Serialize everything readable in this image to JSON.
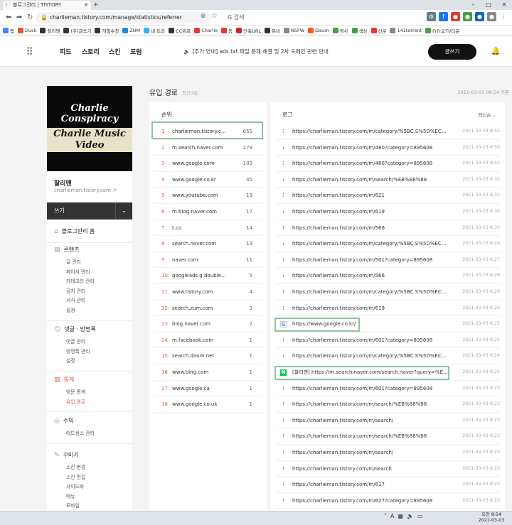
{
  "browser": {
    "tab_title": "블로그관리 | TISTORY",
    "url": "charlieman.tistory.com/manage/statistics/referrer",
    "search_placeholder": "G  검색",
    "bookmarks": [
      {
        "label": "앱",
        "color": "#4285f4"
      },
      {
        "label": "Duck",
        "color": "#de5833"
      },
      {
        "label": "찰리맨",
        "color": "#333333"
      },
      {
        "label": "(주)글쓰기",
        "color": "#333333"
      },
      {
        "label": "개별수정",
        "color": "#333333"
      },
      {
        "label": "ZUM",
        "color": "#1e88e5"
      },
      {
        "label": "내 트라",
        "color": "#29b6f6"
      },
      {
        "label": "CC워프",
        "color": "#333333"
      },
      {
        "label": "Charlie",
        "color": "#e53935"
      },
      {
        "label": "동",
        "color": "#e53935"
      },
      {
        "label": "단축URL",
        "color": "#c62828"
      },
      {
        "label": "뮤비",
        "color": "#333333"
      },
      {
        "label": "NSFW",
        "color": "#888888"
      },
      {
        "label": "Daum",
        "color": "#ff5722"
      },
      {
        "label": "영사",
        "color": "#43a047"
      },
      {
        "label": "색상",
        "color": "#43a047"
      },
      {
        "label": "신문",
        "color": "#e53935"
      },
      {
        "label": "141torrent",
        "color": "#888888"
      },
      {
        "label": "FrFr오TV다운",
        "color": "#43a047"
      }
    ]
  },
  "topnav": {
    "items": [
      "피드",
      "스토리",
      "스킨",
      "포럼"
    ],
    "notice": "[추가 안내] ads.txt 파일 문제 해결 및 2차 도메인 관련 안내",
    "write_button": "글쓰기"
  },
  "sidebar": {
    "blog_image_line1": "Charlie Conspiracy",
    "blog_image_line2": "Charlie Music Video",
    "blog_name": "찰리맨",
    "blog_url": "charlieman.tistory.com",
    "write": "쓰기",
    "home": "블로그관리 홈",
    "sections": [
      {
        "title": "콘텐츠",
        "icon": "document-icon",
        "items": [
          "글 관리",
          "페이지 관리",
          "카테고리 관리",
          "공지 관리",
          "서식 관리",
          "설정"
        ]
      },
      {
        "title": "댓글 · 방명록",
        "icon": "comment-icon",
        "items": [
          "댓글 관리",
          "방명록 관리",
          "설정"
        ]
      },
      {
        "title": "통계",
        "icon": "chart-icon",
        "items": [
          "방문 통계",
          "유입 경로"
        ]
      },
      {
        "title": "수익",
        "icon": "money-icon",
        "items": [
          "애드센스 관리"
        ]
      },
      {
        "title": "꾸미기",
        "icon": "brush-icon",
        "items": [
          "스킨 변경",
          "스킨 편집",
          "사이드바",
          "메뉴",
          "모바일"
        ]
      }
    ]
  },
  "page": {
    "title": "유입 경로",
    "subtitle": "최근3일",
    "date": "2021-03-03 08:54 기준"
  },
  "ranking": {
    "header": "순위",
    "rows": [
      {
        "rank": "1",
        "domain": "charlieman.tistory.c…",
        "count": "655"
      },
      {
        "rank": "2",
        "domain": "m.search.naver.com",
        "count": "278"
      },
      {
        "rank": "3",
        "domain": "www.google.com",
        "count": "103"
      },
      {
        "rank": "4",
        "domain": "www.google.co.kr",
        "count": "45"
      },
      {
        "rank": "5",
        "domain": "www.youtube.com",
        "count": "19"
      },
      {
        "rank": "6",
        "domain": "m.blog.naver.com",
        "count": "17"
      },
      {
        "rank": "7",
        "domain": "t.co",
        "count": "14"
      },
      {
        "rank": "8",
        "domain": "search.naver.com",
        "count": "13"
      },
      {
        "rank": "9",
        "domain": "naver.com",
        "count": "11"
      },
      {
        "rank": "10",
        "domain": "googleads.g.double…",
        "count": "5"
      },
      {
        "rank": "11",
        "domain": "www.tistory.com",
        "count": "4"
      },
      {
        "rank": "12",
        "domain": "search.zum.com",
        "count": "3"
      },
      {
        "rank": "13",
        "domain": "blog.naver.com",
        "count": "2"
      },
      {
        "rank": "14",
        "domain": "m.facebook.com",
        "count": "1"
      },
      {
        "rank": "15",
        "domain": "search.daum.net",
        "count": "1"
      },
      {
        "rank": "16",
        "domain": "www.bing.com",
        "count": "1"
      },
      {
        "rank": "17",
        "domain": "www.google.ca",
        "count": "1"
      },
      {
        "rank": "18",
        "domain": "www.google.co.uk",
        "count": "1"
      }
    ]
  },
  "log": {
    "header": "로그",
    "sort": "최신순",
    "rows": [
      {
        "icon": "tistory",
        "url": "https://charlieman.tistory.com/m/category/%5BC.S%5D%EC%…",
        "time": "2021-03-03 8:52"
      },
      {
        "icon": "tistory",
        "url": "https://charlieman.tistory.com/m/480?category=895608",
        "time": "2021-03-03 8:50"
      },
      {
        "icon": "tistory",
        "url": "https://charlieman.tistory.com/m/480?category=895608",
        "time": "2021-03-03 8:42"
      },
      {
        "icon": "tistory",
        "url": "https://charlieman.tistory.com/m/search/%EB%88%88",
        "time": "2021-03-03 8:32"
      },
      {
        "icon": "tistory",
        "url": "https://charlieman.tistory.com/m/621",
        "time": "2021-03-03 8:31"
      },
      {
        "icon": "tistory",
        "url": "https://charlieman.tistory.com/m/619",
        "time": "2021-03-03 8:30"
      },
      {
        "icon": "tistory",
        "url": "https://charlieman.tistory.com/m/566",
        "time": "2021-03-03 8:30"
      },
      {
        "icon": "tistory",
        "url": "https://charlieman.tistory.com/m/category/%5BC.S%5D%EC%…",
        "time": "2021-03-03 8:28"
      },
      {
        "icon": "tistory",
        "url": "https://charlieman.tistory.com/m/501?category=895608",
        "time": "2021-03-03 8:27"
      },
      {
        "icon": "tistory",
        "url": "https://charlieman.tistory.com/m/566",
        "time": "2021-03-03 8:26"
      },
      {
        "icon": "tistory",
        "url": "https://charlieman.tistory.com/m/category/%5BC.S%5D%EC%…",
        "time": "2021-03-03 8:26"
      },
      {
        "icon": "tistory",
        "url": "https://charlieman.tistory.com/m/619",
        "time": "2021-03-03 8:26"
      },
      {
        "icon": "google",
        "url": "https://www.google.co.kr/",
        "time": "2021-03-03 8:25"
      },
      {
        "icon": "tistory",
        "url": "https://charlieman.tistory.com/m/601?category=895608",
        "time": "2021-03-03 8:24"
      },
      {
        "icon": "tistory",
        "url": "https://charlieman.tistory.com/m/category/%5BC.S%5D%EC%…",
        "time": "2021-03-03 8:24"
      },
      {
        "icon": "naver",
        "url": "[찰리맨] https://m.search.naver.com/search.naver?query=%EC…",
        "time": "2021-03-03 8:24"
      },
      {
        "icon": "tistory",
        "url": "https://charlieman.tistory.com/m/601?category=895608",
        "time": "2021-03-03 8:23"
      },
      {
        "icon": "tistory",
        "url": "https://charlieman.tistory.com/m/search/%EB%88%88",
        "time": "2021-03-03 8:23"
      },
      {
        "icon": "tistory",
        "url": "https://charlieman.tistory.com/m/search/",
        "time": "2021-03-03 8:23"
      },
      {
        "icon": "tistory",
        "url": "https://charlieman.tistory.com/m/search/%EB%88%88",
        "time": "2021-03-03 8:23"
      },
      {
        "icon": "tistory",
        "url": "https://charlieman.tistory.com/m/search/",
        "time": "2021-03-03 8:23"
      },
      {
        "icon": "tistory",
        "url": "https://charlieman.tistory.com/m/search",
        "time": "2021-03-03 8:23"
      },
      {
        "icon": "tistory",
        "url": "https://charlieman.tistory.com/m/617",
        "time": "2021-03-03 8:23"
      },
      {
        "icon": "tistory",
        "url": "https://charlieman.tistory.com/m/627?category=895608",
        "time": "2021-03-03 8:23"
      }
    ]
  },
  "taskbar": {
    "clock_line1": "오전 8:54",
    "clock_line2": "2021-03-03"
  },
  "colors": {
    "accent": "#e65c3c",
    "highlight_box": "#8fc3a0",
    "naver": "#03c75a"
  }
}
